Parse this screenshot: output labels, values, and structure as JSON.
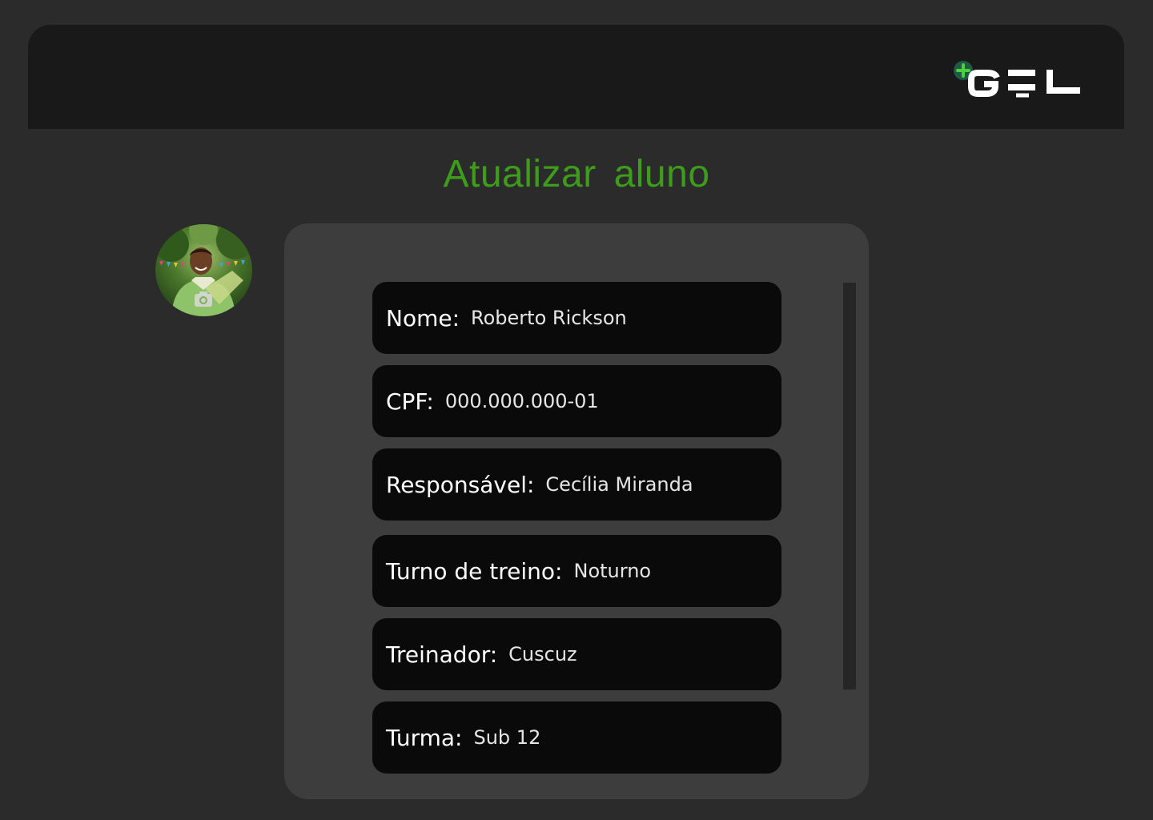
{
  "header": {
    "logo_text": "GOL",
    "logo_icon": "plus-badge-icon",
    "logo_accent": "#3d9c1a"
  },
  "page": {
    "title": "Atualizar aluno"
  },
  "avatar": {
    "overlay_icon": "camera-icon"
  },
  "form": {
    "fields": [
      {
        "label": "Nome:",
        "value": "Roberto Rickson"
      },
      {
        "label": "CPF:",
        "value": "000.000.000-01"
      },
      {
        "label": "Responsável:",
        "value": "Cecília Miranda"
      },
      {
        "label": "Turno de treino:",
        "value": "Noturno"
      },
      {
        "label": "Treinador:",
        "value": "Cuscuz"
      },
      {
        "label": "Turma:",
        "value": "Sub 12"
      }
    ]
  },
  "colors": {
    "background": "#2b2b2b",
    "header": "#191919",
    "panel": "#3d3d3d",
    "field": "#0a0a0a",
    "title": "#3d9c1a"
  }
}
